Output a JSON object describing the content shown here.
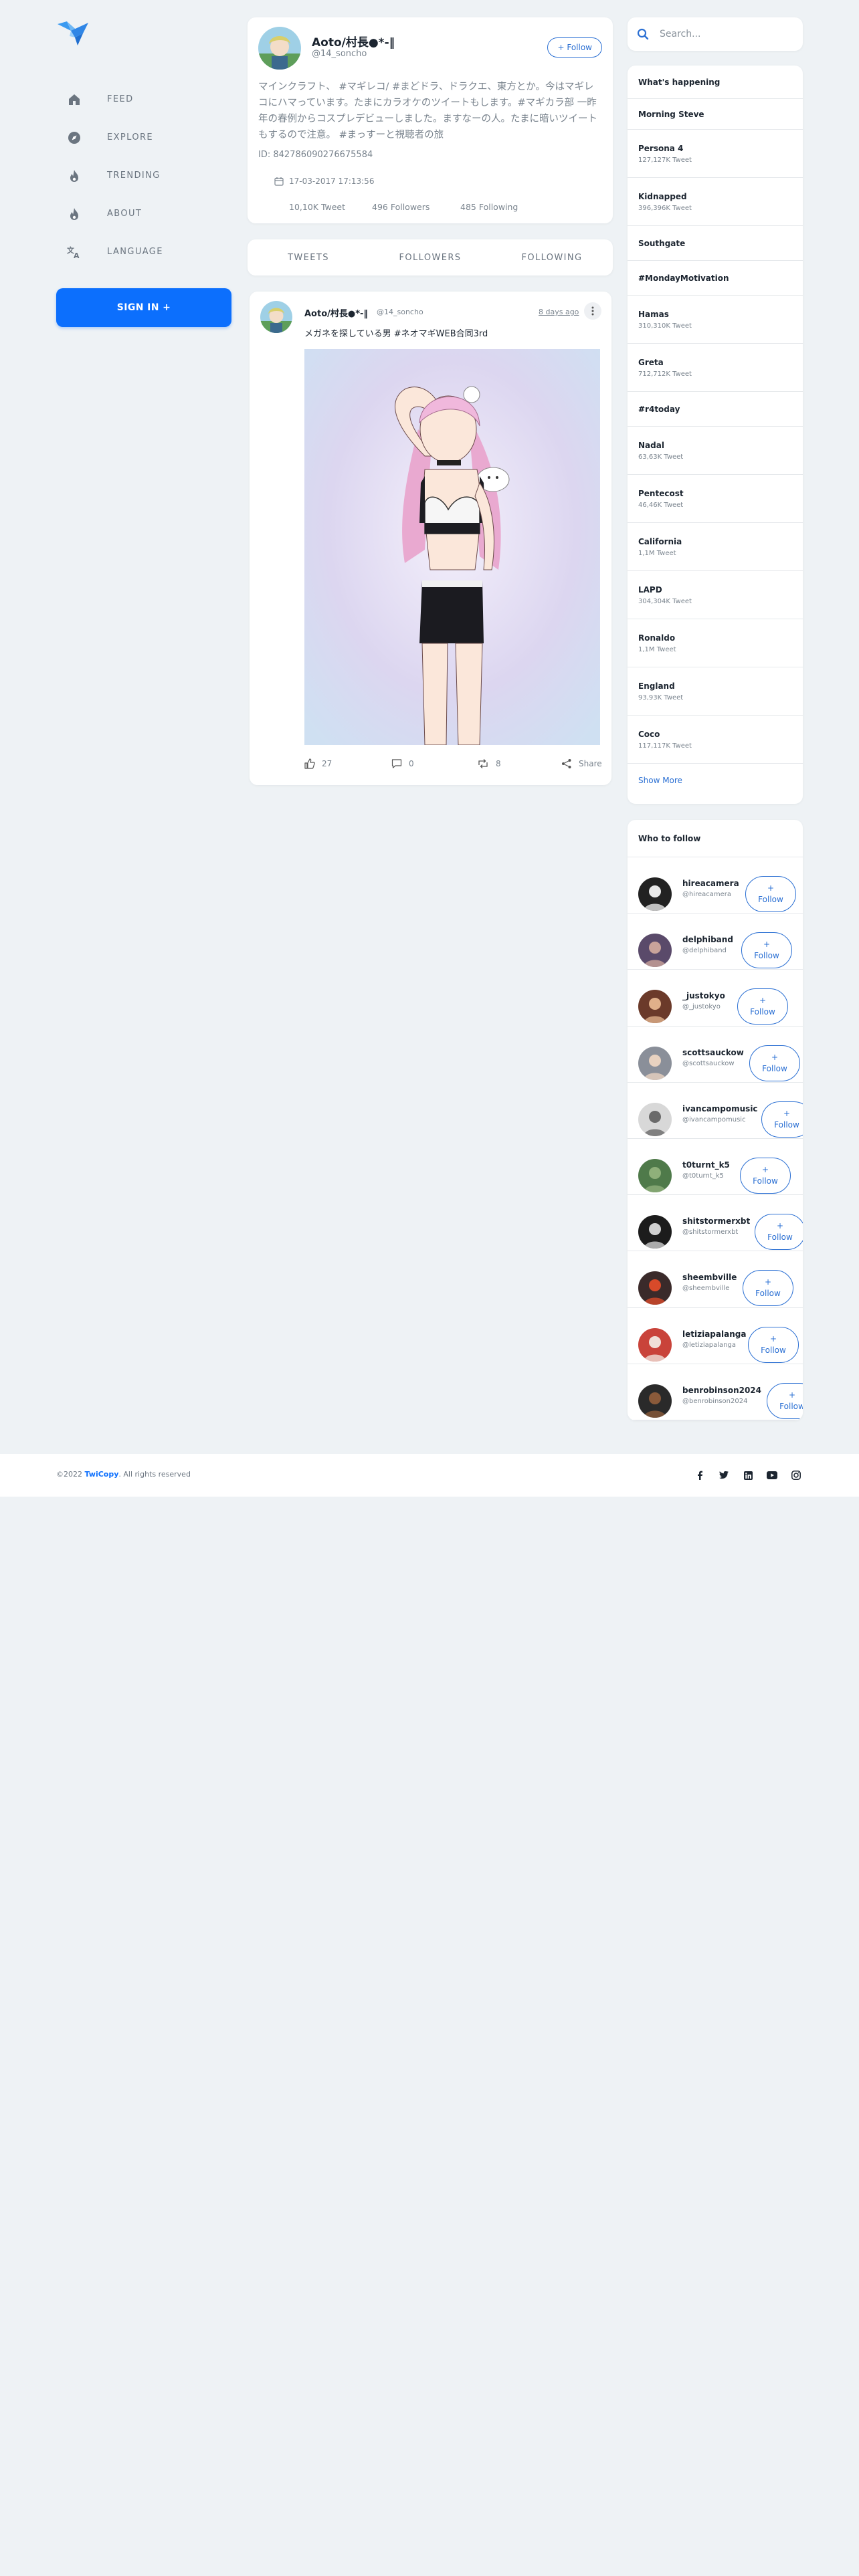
{
  "nav": {
    "items": [
      {
        "label": "FEED",
        "icon": "home-icon"
      },
      {
        "label": "EXPLORE",
        "icon": "compass-icon"
      },
      {
        "label": "TRENDING",
        "icon": "flame-icon"
      },
      {
        "label": "ABOUT",
        "icon": "flame-icon"
      },
      {
        "label": "LANGUAGE",
        "icon": "translate-icon"
      }
    ],
    "signin_label": "SIGN IN +"
  },
  "profile": {
    "name": "Aoto/村長●*-‖",
    "handle": "@14_soncho",
    "follow_label": "+ Follow",
    "bio": "マインクラフト、 #マギレコ/ #まどドラ、ドラクエ、東方とか。今はマギレコにハマっています。たまにカラオケのツイートもします。#マギカラ部 一昨年の春例からコスプレデビューしました。ますなーの人。たまに暗いツイートもするので注意。 #まっすーと視聴者の旅",
    "id_text": "ID: 842786090276675584",
    "joined": "17-03-2017 17:13:56",
    "stats": {
      "tweets": "10,10K Tweet",
      "followers": "496 Followers",
      "following": "485 Following"
    }
  },
  "tabs": [
    "TWEETS",
    "FOLLOWERS",
    "FOLLOWING"
  ],
  "tweet": {
    "name": "Aoto/村長●*-‖",
    "handle": "@14_soncho",
    "time": "8 days ago",
    "text": "メガネを探している男 #ネオマギWEB合同3rd",
    "likes": "27",
    "comments": "0",
    "retweets": "8",
    "share_label": "Share"
  },
  "search": {
    "placeholder": "Search..."
  },
  "trends": {
    "title": "What's happening",
    "items": [
      {
        "name": "Morning Steve",
        "count": ""
      },
      {
        "name": "Persona 4",
        "count": "127,127K Tweet"
      },
      {
        "name": "Kidnapped",
        "count": "396,396K Tweet"
      },
      {
        "name": "Southgate",
        "count": ""
      },
      {
        "name": "#MondayMotivation",
        "count": ""
      },
      {
        "name": "Hamas",
        "count": "310,310K Tweet"
      },
      {
        "name": "Greta",
        "count": "712,712K Tweet"
      },
      {
        "name": "#r4today",
        "count": ""
      },
      {
        "name": "Nadal",
        "count": "63,63K Tweet"
      },
      {
        "name": "Pentecost",
        "count": "46,46K Tweet"
      },
      {
        "name": "California",
        "count": "1,1M Tweet"
      },
      {
        "name": "LAPD",
        "count": "304,304K Tweet"
      },
      {
        "name": "Ronaldo",
        "count": "1,1M Tweet"
      },
      {
        "name": "England",
        "count": "93,93K Tweet"
      },
      {
        "name": "Coco",
        "count": "117,117K Tweet"
      }
    ],
    "show_more": "Show More"
  },
  "who_to_follow": {
    "title": "Who to follow",
    "follow_plus": "+",
    "follow_word": "Follow",
    "items": [
      {
        "name": "hireacamera",
        "handle": "@hireacamera"
      },
      {
        "name": "delphiband",
        "handle": "@delphiband"
      },
      {
        "name": "_justokyo",
        "handle": "@_justokyo"
      },
      {
        "name": "scottsauckow",
        "handle": "@scottsauckow"
      },
      {
        "name": "ivancampomusic",
        "handle": "@ivancampomusic"
      },
      {
        "name": "t0turnt_k5",
        "handle": "@t0turnt_k5"
      },
      {
        "name": "shitstormerxbt",
        "handle": "@shitstormerxbt"
      },
      {
        "name": "sheembville",
        "handle": "@sheembville"
      },
      {
        "name": "letiziapalanga",
        "handle": "@letiziapalanga"
      },
      {
        "name": "benrobinson2024",
        "handle": "@benrobinson2024"
      }
    ]
  },
  "footer": {
    "year": "©2022",
    "brand": "TwiCopy",
    "rights": ". All rights reserved",
    "socials": [
      "facebook-icon",
      "twitter-icon",
      "linkedin-icon",
      "youtube-icon",
      "instagram-icon"
    ]
  },
  "colors": {
    "accent": "#0c6ffd",
    "link": "#2a6fd3",
    "background": "#eef2f5"
  }
}
